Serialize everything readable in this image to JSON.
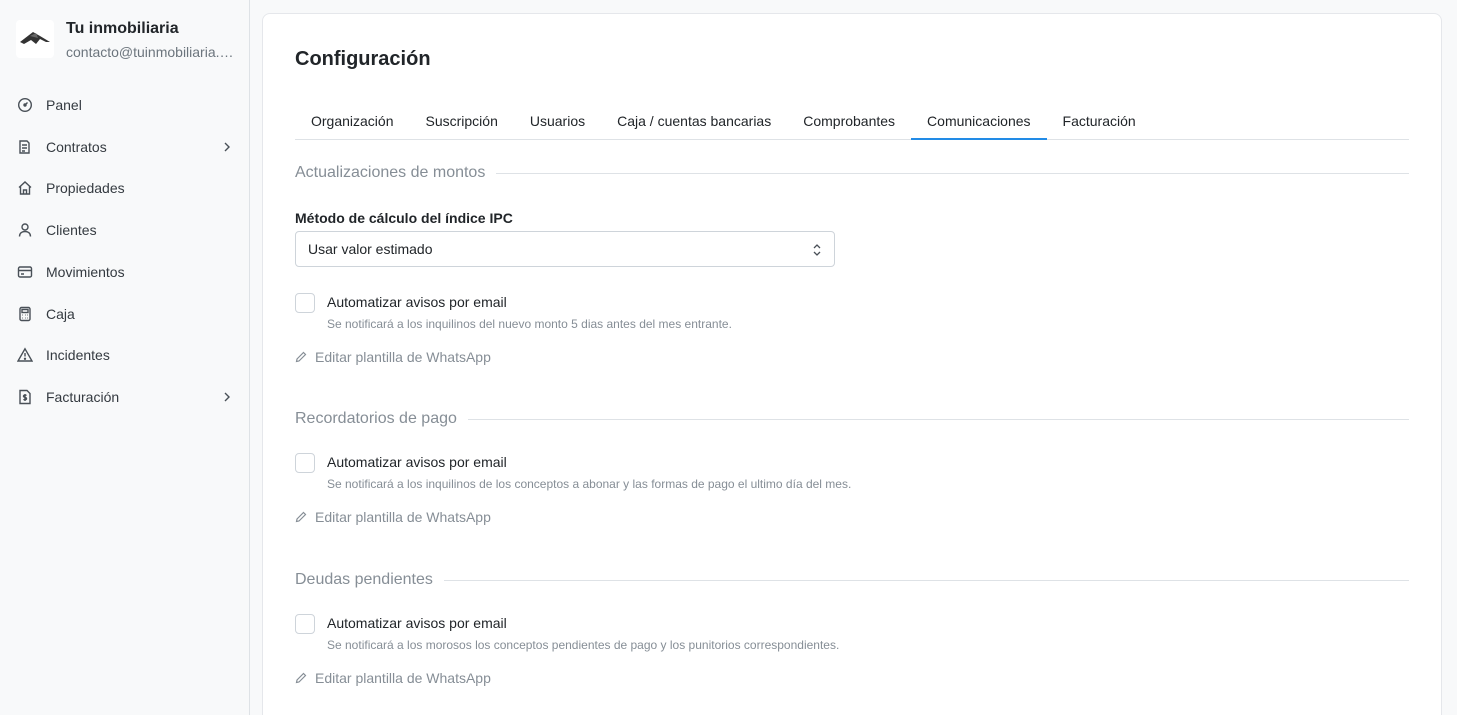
{
  "org": {
    "name": "Tu inmobiliaria",
    "email": "contacto@tuinmobiliaria.com",
    "logo_icon": "house-logo-icon"
  },
  "sidebar": {
    "items": [
      {
        "label": "Panel",
        "icon": "gauge-icon",
        "has_submenu": false
      },
      {
        "label": "Contratos",
        "icon": "contract-icon",
        "has_submenu": true
      },
      {
        "label": "Propiedades",
        "icon": "home-icon",
        "has_submenu": false
      },
      {
        "label": "Clientes",
        "icon": "user-icon",
        "has_submenu": false
      },
      {
        "label": "Movimientos",
        "icon": "credit-card-icon",
        "has_submenu": false
      },
      {
        "label": "Caja",
        "icon": "calculator-icon",
        "has_submenu": false
      },
      {
        "label": "Incidentes",
        "icon": "warning-icon",
        "has_submenu": false
      },
      {
        "label": "Facturación",
        "icon": "invoice-icon",
        "has_submenu": true
      }
    ]
  },
  "page": {
    "title": "Configuración"
  },
  "tabs": [
    {
      "label": "Organización",
      "active": false
    },
    {
      "label": "Suscripción",
      "active": false
    },
    {
      "label": "Usuarios",
      "active": false
    },
    {
      "label": "Caja / cuentas bancarias",
      "active": false
    },
    {
      "label": "Comprobantes",
      "active": false
    },
    {
      "label": "Comunicaciones",
      "active": true
    },
    {
      "label": "Facturación",
      "active": false
    }
  ],
  "sections": {
    "montos": {
      "title": "Actualizaciones de montos",
      "ipc_label": "Método de cálculo del índice IPC",
      "ipc_value": "Usar valor estimado",
      "email_label": "Automatizar avisos por email",
      "email_checked": false,
      "email_desc": "Se notificará a los inquilinos del nuevo monto 5 dias antes del mes entrante.",
      "whatsapp_label": "Editar plantilla de WhatsApp"
    },
    "recordatorios": {
      "title": "Recordatorios de pago",
      "email_label": "Automatizar avisos por email",
      "email_checked": false,
      "email_desc": "Se notificará a los inquilinos de los conceptos a abonar y las formas de pago el ultimo día del mes.",
      "whatsapp_label": "Editar plantilla de WhatsApp"
    },
    "deudas": {
      "title": "Deudas pendientes",
      "email_label": "Automatizar avisos por email",
      "email_checked": false,
      "email_desc": "Se notificará a los morosos los conceptos pendientes de pago y los punitorios correspondientes.",
      "whatsapp_label": "Editar plantilla de WhatsApp"
    }
  },
  "colors": {
    "accent": "#228be6",
    "muted_text": "#868e96",
    "border": "#dee2e6"
  }
}
